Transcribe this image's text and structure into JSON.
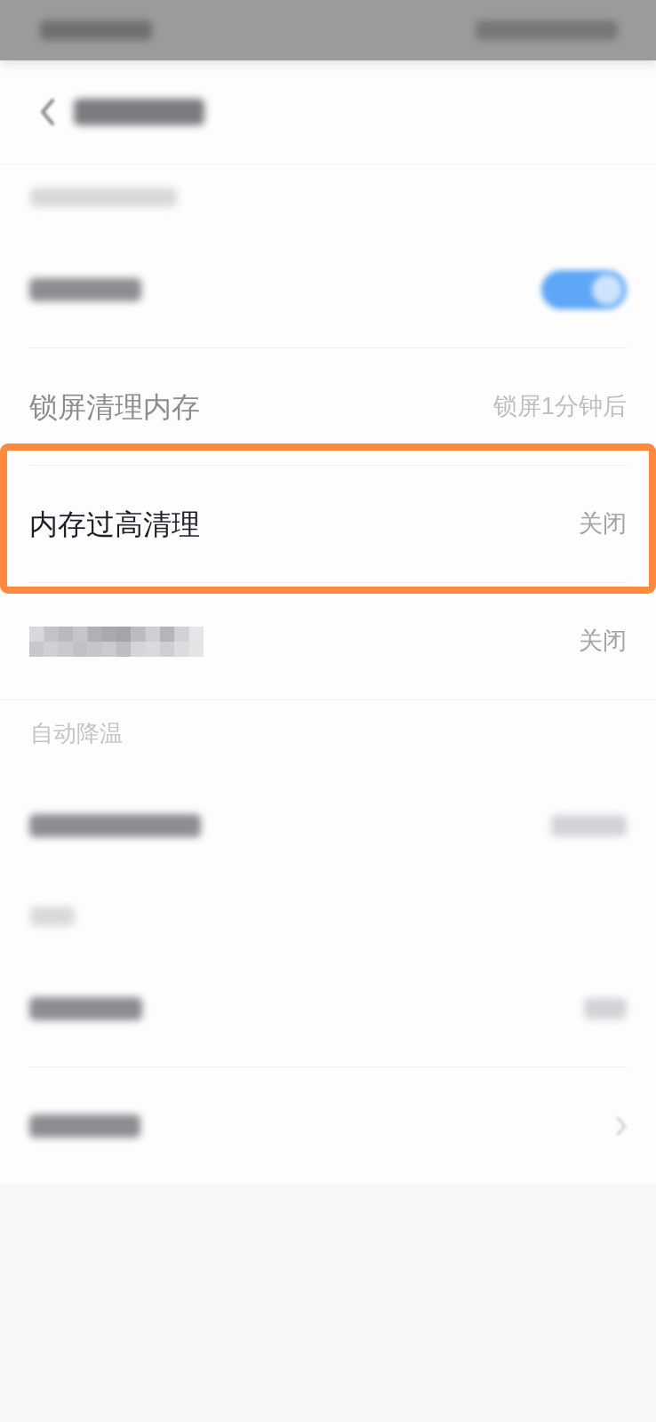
{
  "status_bar": {
    "left_blurred": true,
    "right_blurred": true
  },
  "header": {
    "title_blurred": true
  },
  "sections": [
    {
      "header_blurred": true,
      "rows": [
        {
          "kind": "toggle",
          "label_blurred": true,
          "on": true,
          "highlighted": false
        },
        {
          "kind": "value",
          "label": "锁屏清理内存",
          "value": "锁屏1分钟后",
          "dimmed": true,
          "highlighted": false
        },
        {
          "kind": "value",
          "label": "内存过高清理",
          "value": "关闭",
          "dimmed": false,
          "highlighted": true
        },
        {
          "kind": "value",
          "label_pixelated": true,
          "value": "关闭",
          "dimmed": false,
          "highlighted": false
        }
      ]
    },
    {
      "header": "自动降温",
      "rows": [
        {
          "kind": "value",
          "label_blurred": true,
          "value_blurred": true,
          "highlighted": false
        }
      ]
    },
    {
      "header_blurred": true,
      "rows": [
        {
          "kind": "value",
          "label_blurred": true,
          "value_blurred": true,
          "highlighted": false
        },
        {
          "kind": "link",
          "label_blurred": true,
          "highlighted": false
        }
      ]
    }
  ]
}
